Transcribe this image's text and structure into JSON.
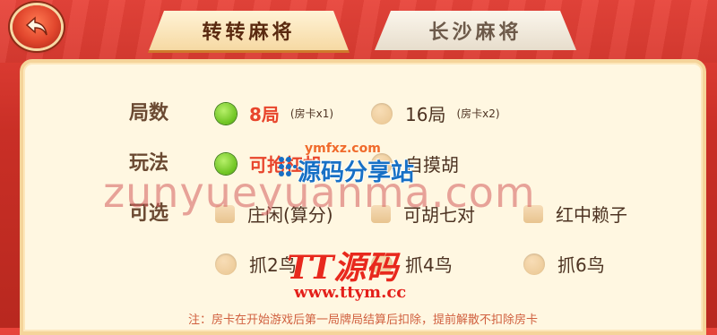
{
  "tabs": {
    "active": "转转麻将",
    "inactive": "长沙麻将"
  },
  "rows": {
    "rounds": {
      "label": "局数",
      "options": [
        {
          "label": "8局",
          "sub": "(房卡x1)",
          "selected": true
        },
        {
          "label": "16局",
          "sub": "(房卡x2)",
          "selected": false
        }
      ]
    },
    "play": {
      "label": "玩法",
      "options": [
        {
          "label": "可抢杠胡",
          "selected": true
        },
        {
          "label": "自摸胡",
          "selected": false
        }
      ]
    },
    "optional": {
      "label": "可选",
      "options": [
        {
          "label": "庄闲(算分)",
          "checked": false
        },
        {
          "label": "可胡七对",
          "checked": false
        },
        {
          "label": "红中赖子",
          "checked": false
        }
      ]
    },
    "birds": {
      "options": [
        {
          "label": "抓2鸟",
          "selected": false
        },
        {
          "label": "抓4鸟",
          "selected": false
        },
        {
          "label": "抓6鸟",
          "selected": false
        }
      ]
    }
  },
  "note": "注：房卡在开始游戏后第一局牌局结算后扣除，提前解散不扣除房卡",
  "watermarks": {
    "big": "zunyueyuanma.com",
    "small": "ymfxz.com",
    "logo": "源码分享站",
    "tt": "TT源码",
    "url": "www.ttym.cc"
  },
  "colors": {
    "background": "#c92f26",
    "panel": "#fff7e1",
    "selected_radio": "#6cc21f",
    "selected_text": "#e8452c"
  }
}
